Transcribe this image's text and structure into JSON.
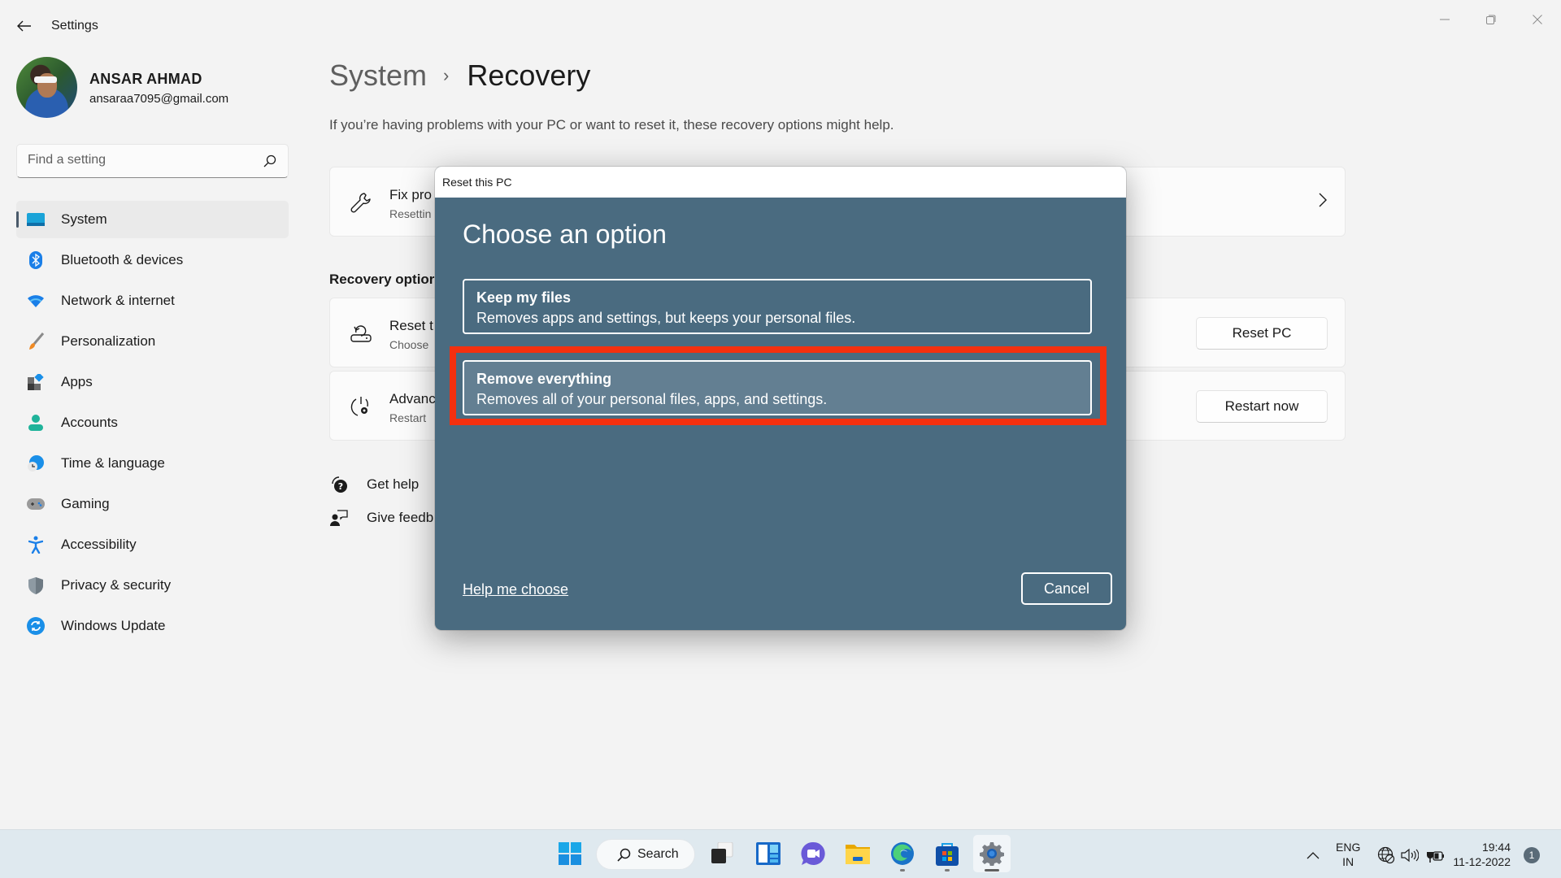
{
  "window": {
    "title": "Settings",
    "controls": {
      "minimize": "minimize-icon",
      "maximize": "restore-icon",
      "close": "close-icon"
    }
  },
  "user": {
    "name": "ANSAR AHMAD",
    "email": "ansaraa7095@gmail.com"
  },
  "search": {
    "placeholder": "Find a setting",
    "value": ""
  },
  "sidebar": {
    "items": [
      {
        "label": "System",
        "icon": "system-icon",
        "active": true
      },
      {
        "label": "Bluetooth & devices",
        "icon": "bluetooth-icon"
      },
      {
        "label": "Network & internet",
        "icon": "wifi-icon"
      },
      {
        "label": "Personalization",
        "icon": "brush-icon"
      },
      {
        "label": "Apps",
        "icon": "apps-icon"
      },
      {
        "label": "Accounts",
        "icon": "account-icon"
      },
      {
        "label": "Time & language",
        "icon": "globe-clock-icon"
      },
      {
        "label": "Gaming",
        "icon": "gamepad-icon"
      },
      {
        "label": "Accessibility",
        "icon": "accessibility-icon"
      },
      {
        "label": "Privacy & security",
        "icon": "shield-icon"
      },
      {
        "label": "Windows Update",
        "icon": "update-icon"
      }
    ]
  },
  "main": {
    "breadcrumb": {
      "parent": "System",
      "separator": "›",
      "current": "Recovery"
    },
    "description": "If you’re having problems with your PC or want to reset it, these recovery options might help.",
    "fix_card": {
      "title": "Fix pro",
      "subtitle": "Resettin"
    },
    "section_title": "Recovery optior",
    "reset_card": {
      "title": "Reset t",
      "subtitle": "Choose",
      "button": "Reset PC"
    },
    "advanced_card": {
      "title": "Advanc",
      "subtitle": "Restart",
      "button": "Restart now"
    },
    "links": {
      "get_help": "Get help",
      "give_feedback": "Give feedb"
    }
  },
  "dialog": {
    "title": "Reset this PC",
    "heading": "Choose an option",
    "options": [
      {
        "title": "Keep my files",
        "subtitle": "Removes apps and settings, but keeps your personal files."
      },
      {
        "title": "Remove everything",
        "subtitle": "Removes all of your personal files, apps, and settings.",
        "highlighted": true
      }
    ],
    "help_link": "Help me choose",
    "cancel": "Cancel",
    "colors": {
      "background": "#4a6b80",
      "selected": "#637f92",
      "highlight": "#f4300f"
    }
  },
  "taskbar": {
    "search_label": "Search",
    "apps": [
      "start-icon",
      "search",
      "task-view-icon",
      "widgets-icon",
      "chat-icon",
      "file-explorer-icon",
      "edge-icon",
      "store-icon",
      "settings-icon"
    ],
    "tray": {
      "language": "ENG",
      "region": "IN",
      "time": "19:44",
      "date": "11-12-2022",
      "notifications": "1"
    }
  }
}
